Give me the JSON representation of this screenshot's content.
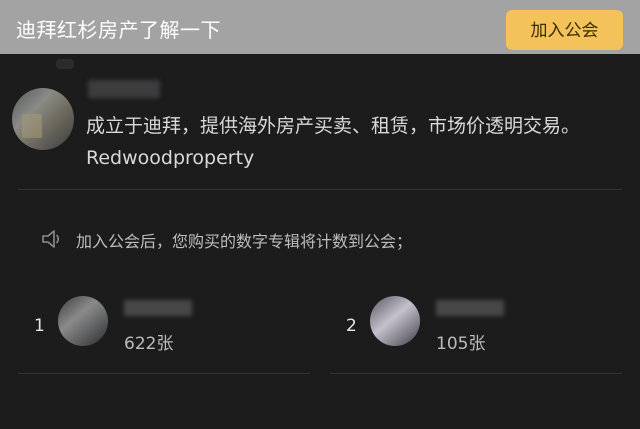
{
  "header": {
    "title": "迪拜红杉房产了解一下",
    "join_label": "加入公会"
  },
  "profile": {
    "description": "成立于迪拜，提供海外房产买卖、租赁，市场价透明交易。Redwoodproperty"
  },
  "notice": {
    "icon": "speaker-icon",
    "text": "加入公会后，您购买的数字专辑将计数到公会；"
  },
  "members": [
    {
      "rank": "1",
      "count": "622张"
    },
    {
      "rank": "2",
      "count": "105张"
    }
  ],
  "colors": {
    "header_bg": "#a3a3a3",
    "accent": "#f3c25a",
    "background": "#1c1c1d"
  }
}
